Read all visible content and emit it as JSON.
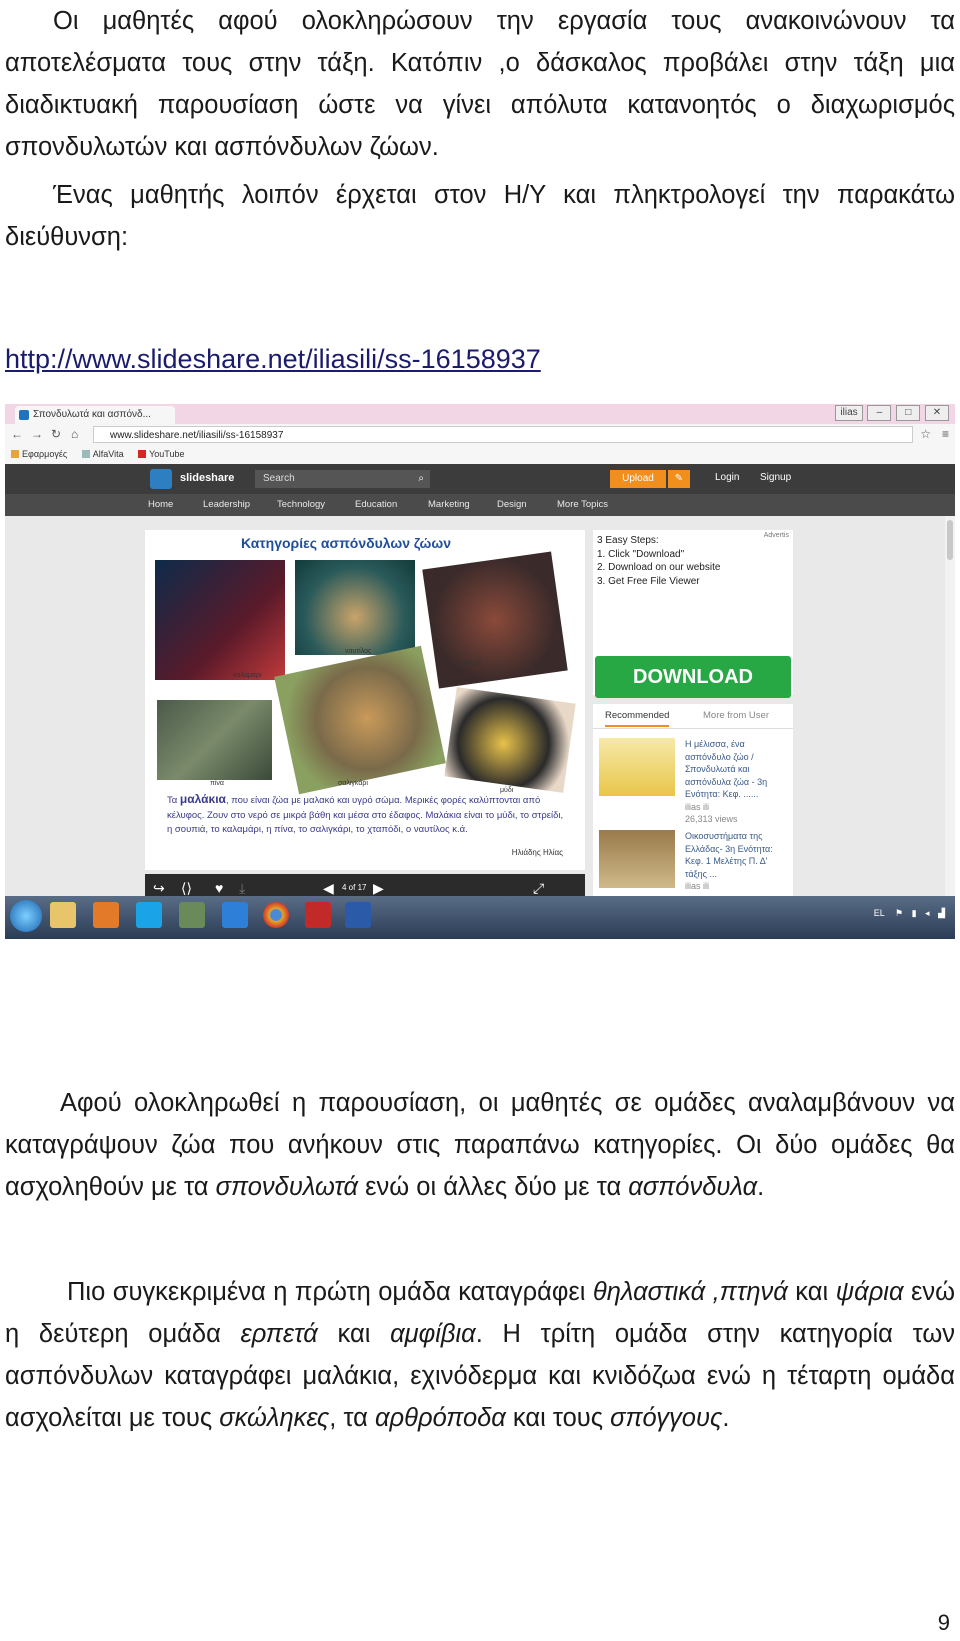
{
  "paragraphs": {
    "p1": "Οι μαθητές αφού ολοκληρώσουν την εργασία τους ανακοινώνουν τα αποτελέσματα τους στην τάξη. Κατόπιν ,ο δάσκαλος προβάλει στην τάξη μια διαδικτυακή παρουσίαση ώστε να γίνει απόλυτα κατανοητός ο διαχωρισμός σπονδυλωτών και ασπόνδυλων ζώων.",
    "p2": "Ένας μαθητής λοιπόν έρχεται στον Η/Υ και πληκτρολογεί την παρακάτω διεύθυνση:",
    "url": "http://www.slideshare.net/iliasili/ss-16158937",
    "p3_a": "Αφού ολοκληρωθεί η παρουσίαση, οι μαθητές σε ομάδες αναλαμβάνουν να καταγράψουν ζώα που ανήκουν στις παραπάνω κατηγορίες. Οι δύο ομάδες θα ασχοληθούν με τα ",
    "p3_i1": "σπονδυλωτά",
    "p3_b": " ενώ οι άλλες δύο με τα ",
    "p3_i2": "ασπόνδυλα",
    "p3_c": ".",
    "p4_a": "Πιο συγκεκριμένα η πρώτη ομάδα  καταγράφει ",
    "p4_i1": "θηλαστικά ,πτηνά",
    "p4_b": " και ",
    "p4_i2": "ψάρια",
    "p4_c": " ενώ η δεύτερη ομάδα ",
    "p4_i3": "ερπετά",
    "p4_d": " και ",
    "p4_i4": "αμφίβια",
    "p4_e": ". Η τρίτη ομάδα στην κατηγορία των ασπόνδυλων καταγράφει μαλάκια, εχινόδερμα και κνιδόζωα ενώ η τέταρτη ομάδα ασχολείται με τους ",
    "p4_i5": "σκώληκες",
    "p4_f": ", τα ",
    "p4_i6": "αρθρόποδα",
    "p4_g": " και τους ",
    "p4_i7": "σπόγγους",
    "p4_h": "."
  },
  "page_number": "9",
  "screenshot": {
    "tab_title": "Σπονδυλωτά και ασπόνδ...",
    "user_button": "ilias",
    "address": "www.slideshare.net/iliasili/ss-16158937",
    "bookmarks": [
      "Εφαρμογές",
      "AlfaVita",
      "YouTube"
    ],
    "brand": "slideshare",
    "search_placeholder": "Search",
    "upload": "Upload",
    "login": "Login",
    "signup": "Signup",
    "nav": [
      "Home",
      "Leadership",
      "Technology",
      "Education",
      "Marketing",
      "Design",
      "More Topics"
    ],
    "slide": {
      "title": "Κατηγορίες ασπόνδυλων ζώων",
      "labels": [
        "καλαμάρι",
        "ναυτίλος",
        "χταπόδι",
        "πίνα",
        "σαλιγκάρι",
        "μύδι"
      ],
      "text_bold": "μαλάκια",
      "text_pre": "Τα ",
      "text_post": ", που είναι ζώα με μαλακό και υγρό σώμα. Μερικές φορές καλύπτονται από κέλυφος. Ζουν στο νερό σε μικρά βάθη και μέσα στο έδαφος. Μαλάκια είναι το μύδι, το στρείδι, η σουπιά, το καλαμάρι, η πίνα, το σαλιγκάρι, το χταπόδι, ο ναυτίλος κ.ά.",
      "author": "Ηλιάδης Ηλίας",
      "page_indicator": "4 of 17"
    },
    "ad": {
      "label": "Advertis",
      "step1": "3 Easy Steps:",
      "step2": "1. Click \"Download\"",
      "step3": "2. Download on our website",
      "step4": "3. Get Free File Viewer",
      "button": "DOWNLOAD"
    },
    "recommended": {
      "tab1": "Recommended",
      "tab2": "More from User",
      "item1_title": "Η μέλισσα, ένα ασπόνδυλο ζώο / Σπονδυλωτά και ασπόνδυλα ζώα - 3η Ενότητα: Κεφ. ......",
      "item1_author": "ilias ili",
      "item1_views": "26,313 views",
      "item2_title": "Οικοσυστήματα της Ελλάδας- 3η Ενότητα: Κεφ. 1 Μελέτης Π. Δ' τάξης ...",
      "item2_author": "ilias ili"
    },
    "tray_lang": "EL"
  }
}
